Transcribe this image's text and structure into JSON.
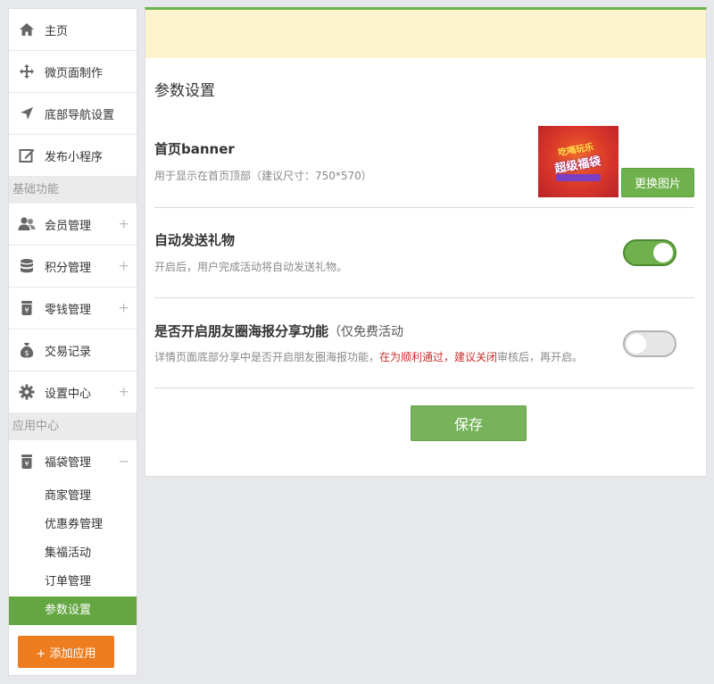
{
  "sidebar": {
    "top_items": [
      {
        "label": "主页",
        "icon": "home-icon"
      },
      {
        "label": "微页面制作",
        "icon": "move-icon"
      },
      {
        "label": "底部导航设置",
        "icon": "navigation-arrow-icon"
      },
      {
        "label": "发布小程序",
        "icon": "edit-icon"
      }
    ],
    "section_basic": "基础功能",
    "basic_items": [
      {
        "label": "会员管理",
        "icon": "users-icon"
      },
      {
        "label": "积分管理",
        "icon": "database-icon"
      },
      {
        "label": "零钱管理",
        "icon": "yen-jar-icon"
      },
      {
        "label": "交易记录",
        "icon": "money-bag-icon"
      },
      {
        "label": "设置中心",
        "icon": "gear-icon"
      }
    ],
    "section_apps": "应用中心",
    "app_item": {
      "label": "福袋管理",
      "icon": "yen-jar-icon"
    },
    "expand_plus": "+",
    "collapse_minus": "−",
    "sub_items": [
      "商家管理",
      "优惠券管理",
      "集福活动",
      "订单管理",
      "参数设置"
    ],
    "add_app_label": "+ 添加应用"
  },
  "main": {
    "page_title": "参数设置",
    "banner": {
      "title": "首页banner",
      "desc": "用于显示在首页顶部（建议尺寸：750*570）",
      "thumb_line1": "吃喝玩乐",
      "thumb_line2": "超级福袋",
      "change_label": "更换图片"
    },
    "gift": {
      "title": "自动发送礼物",
      "desc": "开启后，用户完成活动将自动发送礼物。",
      "enabled": true
    },
    "poster": {
      "title": "是否开启朋友圈海报分享功能",
      "title_note": "（仅免费活动",
      "desc_part1": "详情页面底部分享中是否开启朋友圈海报功能，",
      "desc_red": "在为顺利通过，建议关闭",
      "desc_part2": "审核后，再开启。",
      "enabled": false
    },
    "save_label": "保存"
  },
  "colors": {
    "accent_green": "#6fb14d",
    "active_nav": "#63a642",
    "add_button": "#ed7d1f",
    "notice_strip": "#fcf4cc",
    "warning_red": "#c9302c"
  }
}
